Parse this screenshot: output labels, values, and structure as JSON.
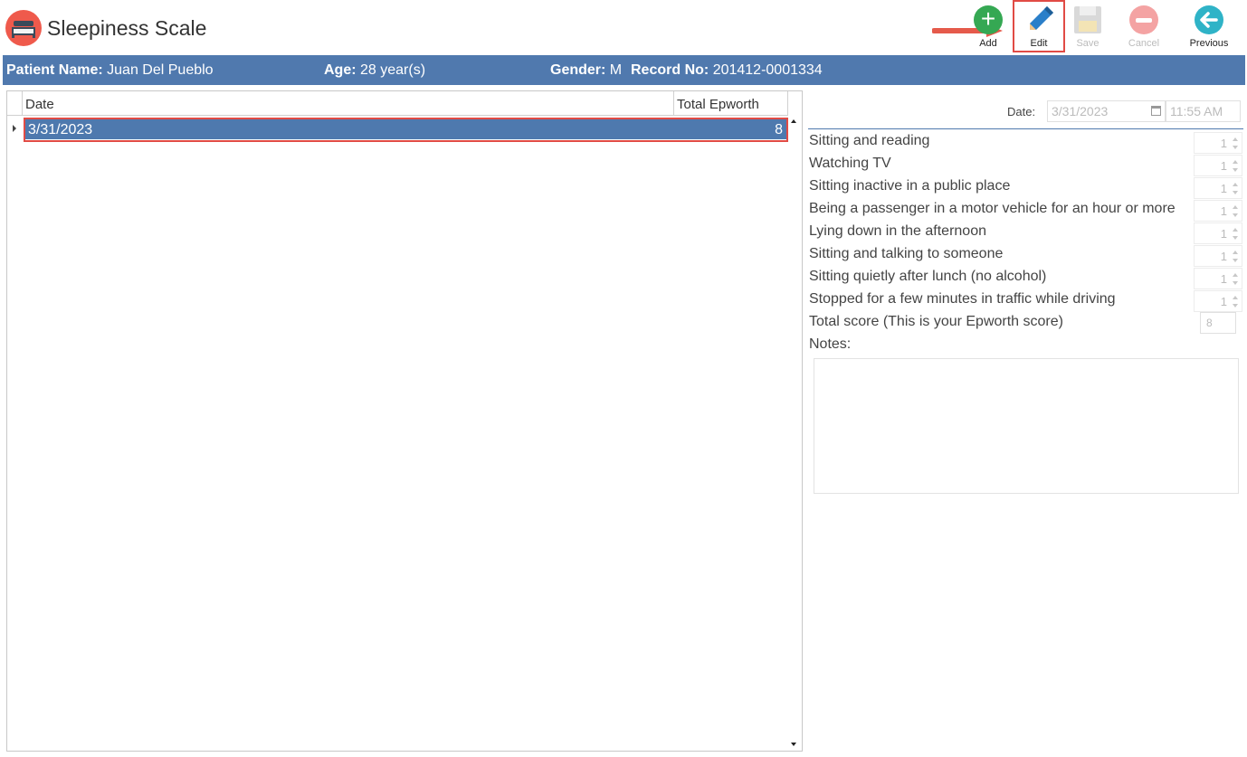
{
  "app": {
    "title": "Sleepiness Scale"
  },
  "toolbar": {
    "add_label": "Add",
    "edit_label": "Edit",
    "save_label": "Save",
    "cancel_label": "Cancel",
    "previous_label": "Previous"
  },
  "patient": {
    "name_label": "Patient Name:",
    "name": "Juan Del Pueblo",
    "age_label": "Age:",
    "age": "28 year(s)",
    "gender_label": "Gender:",
    "gender": "M",
    "record_label": "Record No:",
    "record": "201412-0001334"
  },
  "grid": {
    "columns": [
      "Date",
      "Total Epworth"
    ],
    "rows": [
      {
        "date": "3/31/2023",
        "total": "8"
      }
    ]
  },
  "form": {
    "date_label": "Date:",
    "date_value": "3/31/2023",
    "time_value": "11:55 AM",
    "questions": [
      {
        "label": "Sitting and reading",
        "value": "1"
      },
      {
        "label": "Watching TV",
        "value": "1"
      },
      {
        "label": "Sitting inactive in a public place",
        "value": "1"
      },
      {
        "label": "Being a passenger in a motor vehicle for an hour or more",
        "value": "1"
      },
      {
        "label": "Lying down in the afternoon",
        "value": "1"
      },
      {
        "label": "Sitting and talking to someone",
        "value": "1"
      },
      {
        "label": "Sitting quietly after lunch (no alcohol)",
        "value": "1"
      },
      {
        "label": "Stopped for a few minutes in traffic while driving",
        "value": "1"
      }
    ],
    "total_label": "Total score (This is your Epworth score)",
    "total_value": "8",
    "notes_label": "Notes:",
    "notes_value": ""
  },
  "colors": {
    "banner": "#5079ae",
    "selected_row": "#4e79ae",
    "highlight": "#e14b45",
    "add": "#35a853",
    "edit": "#2a7fc9",
    "previous": "#2fb3c7"
  }
}
